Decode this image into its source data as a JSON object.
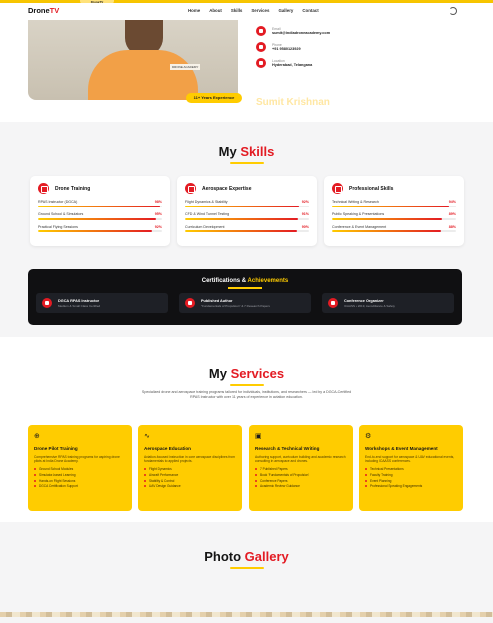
{
  "brand": {
    "logo_main": "Drone",
    "logo_accent": "TV",
    "top_tag": "DroneTV"
  },
  "nav": {
    "items": [
      "Home",
      "About",
      "Skills",
      "Services",
      "Gallery",
      "Contact"
    ],
    "theme_icon": "moon-icon"
  },
  "hero": {
    "photo_badge": "DRONE ACADEMY",
    "experience": "11+ Years Experience",
    "contacts": [
      {
        "label": "Email",
        "value": "sumit@indiadroneacademy.com",
        "icon": "mail-icon"
      },
      {
        "label": "Phone",
        "value": "+91 9580123929",
        "icon": "phone-icon"
      },
      {
        "label": "Location",
        "value": "Hyderabad, Telangana",
        "icon": "location-icon"
      }
    ],
    "name": "Sumit Krishnan"
  },
  "skills": {
    "title_main": "My",
    "title_accent": "Skills",
    "cards": [
      {
        "title": "Drone Training",
        "icon": "drone-icon",
        "items": [
          {
            "name": "RPAS Instructor (DGCA)",
            "pct": "98%",
            "value": 98
          },
          {
            "name": "Ground School & Simulators",
            "pct": "95%",
            "value": 95
          },
          {
            "name": "Practical Flying Sessions",
            "pct": "92%",
            "value": 92
          }
        ]
      },
      {
        "title": "Aerospace Expertise",
        "icon": "plane-icon",
        "items": [
          {
            "name": "Flight Dynamics & Stability",
            "pct": "92%",
            "value": 92
          },
          {
            "name": "CFD & Wind Tunnel Testing",
            "pct": "91%",
            "value": 91
          },
          {
            "name": "Curriculum Development",
            "pct": "90%",
            "value": 90
          }
        ]
      },
      {
        "title": "Professional Skills",
        "icon": "presentation-icon",
        "items": [
          {
            "name": "Technical Writing & Research",
            "pct": "94%",
            "value": 94
          },
          {
            "name": "Public Speaking & Presentations",
            "pct": "89%",
            "value": 89
          },
          {
            "name": "Conference & Event Management",
            "pct": "88%",
            "value": 88
          }
        ]
      }
    ]
  },
  "certs": {
    "title_main": "Certifications &",
    "title_accent": "Achievements",
    "items": [
      {
        "name": "DGCA RPAS Instructor",
        "sub": "Medium & Small Class Certified",
        "icon": "certificate-icon"
      },
      {
        "name": "Published Author",
        "sub": "\"Fundamentals of Propulsion\" & 7 Research Papers",
        "icon": "book-icon"
      },
      {
        "name": "Conference Organizer",
        "sub": "ICAASS • 2019, AeroAlliance & Safety",
        "icon": "users-icon"
      }
    ]
  },
  "services": {
    "title_main": "My",
    "title_accent": "Services",
    "description": "Specialized drone and aerospace training programs tailored for individuals, institutions, and researchers — led by a DGCA-Certified RPAS Instructor with over 11 years of experience in aviation education.",
    "cards": [
      {
        "icon": "drone-icon",
        "glyph": "⊕",
        "title": "Drone Pilot Training",
        "desc": "Comprehensive RPAS training programs for aspiring drone pilots at India Drone Academy.",
        "list": [
          "Ground School Modules",
          "Simulator-based Learning",
          "Hands-on Flight Sessions",
          "DGCA Certification Support"
        ]
      },
      {
        "icon": "pulse-icon",
        "glyph": "∿",
        "title": "Aerospace Education",
        "desc": "Aviation-focused instruction in core aerospace disciplines from fundamentals to applied projects.",
        "list": [
          "Flight Dynamics",
          "Aircraft Performance",
          "Stability & Control",
          "UAV Design Guidance"
        ]
      },
      {
        "icon": "book-icon",
        "glyph": "▣",
        "title": "Research & Technical Writing",
        "desc": "Authoring support, curriculum building and academic research consulting in aerospace and drones.",
        "list": [
          "7 Published Papers",
          "Book 'Fundamentals of Propulsion'",
          "Conference Papers",
          "Academic Review Guidance"
        ]
      },
      {
        "icon": "gear-icon",
        "glyph": "⚙",
        "title": "Workshops & Event Management",
        "desc": "End-to-end support for aerospace & UAV educational events, including ICAASS conferences.",
        "list": [
          "Technical Presentations",
          "Faculty Training",
          "Event Planning",
          "Professional Speaking Engagements"
        ]
      }
    ]
  },
  "gallery": {
    "title_main": "Photo",
    "title_accent": "Gallery"
  }
}
